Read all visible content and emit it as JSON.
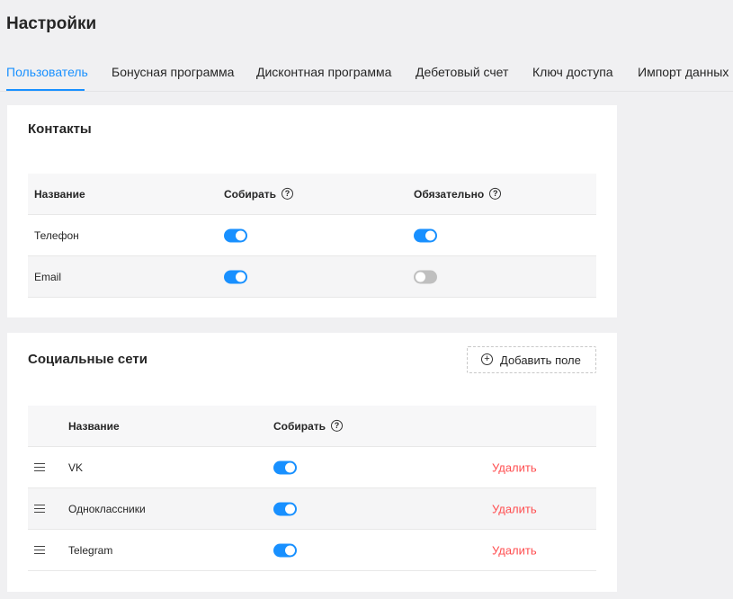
{
  "page": {
    "title": "Настройки"
  },
  "tabs": [
    {
      "label": "Пользователь",
      "active": true
    },
    {
      "label": "Бонусная программа",
      "active": false
    },
    {
      "label": "Дисконтная программа",
      "active": false
    },
    {
      "label": "Дебетовый счет",
      "active": false
    },
    {
      "label": "Ключ доступа",
      "active": false
    },
    {
      "label": "Импорт данных",
      "active": false
    }
  ],
  "contacts": {
    "title": "Контакты",
    "columns": {
      "name": "Название",
      "collect": "Собирать",
      "required": "Обязательно"
    },
    "rows": [
      {
        "name": "Телефон",
        "collect": true,
        "required": true
      },
      {
        "name": "Email",
        "collect": true,
        "required": false
      }
    ]
  },
  "social": {
    "title": "Социальные сети",
    "add_label": "Добавить поле",
    "columns": {
      "name": "Название",
      "collect": "Собирать"
    },
    "delete_label": "Удалить",
    "rows": [
      {
        "name": "VK",
        "collect": true
      },
      {
        "name": "Одноклассники",
        "collect": true
      },
      {
        "name": "Telegram",
        "collect": true
      }
    ]
  },
  "colors": {
    "accent": "#1890ff",
    "danger": "#ff4d4f",
    "toggle_off": "#bfbfbf",
    "background": "#f0f0f2"
  },
  "icons": {
    "help": "question-circle-icon",
    "add": "plus-circle-icon",
    "drag": "drag-handle-icon"
  }
}
